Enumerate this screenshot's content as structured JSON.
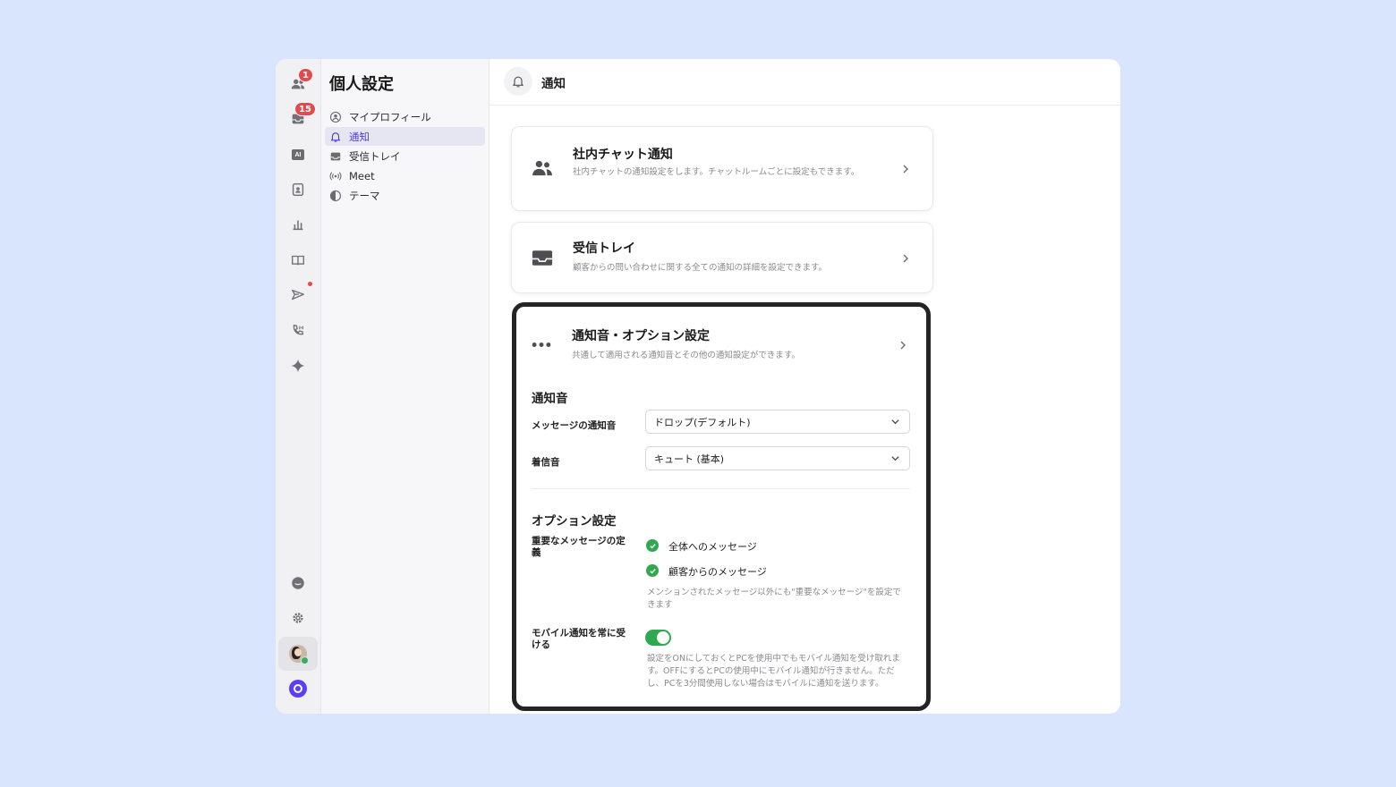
{
  "rail": {
    "contacts_badge": "1",
    "inbox_badge": "15",
    "ai_label": "AI"
  },
  "settings": {
    "title": "個人設定",
    "nav": [
      {
        "label": "マイプロフィール",
        "icon": "user-circle-icon"
      },
      {
        "label": "通知",
        "icon": "bell-icon"
      },
      {
        "label": "受信トレイ",
        "icon": "inbox-icon"
      },
      {
        "label": "Meet",
        "icon": "broadcast-icon"
      },
      {
        "label": "テーマ",
        "icon": "theme-icon"
      }
    ]
  },
  "header": {
    "title": "通知"
  },
  "cards": [
    {
      "title": "社内チャット通知",
      "desc": "社内チャットの通知設定をします。チャットルームごとに設定もできます。",
      "icon": "users-icon"
    },
    {
      "title": "受信トレイ",
      "desc": "顧客からの問い合わせに関する全ての通知の詳細を設定できます。",
      "icon": "inbox-icon"
    },
    {
      "title": "通知音・オプション設定",
      "desc": "共通して適用される通知音とその他の通知設定ができます。",
      "icon": "more-icon"
    }
  ],
  "sounds": {
    "title": "通知音",
    "message_label": "メッセージの通知音",
    "message_value": "ドロップ(デフォルト)",
    "ring_label": "着信音",
    "ring_value": "キュート (基本)"
  },
  "options": {
    "title": "オプション設定",
    "important_label": "重要なメッセージの定義",
    "checks": [
      {
        "label": "全体へのメッセージ",
        "checked": true
      },
      {
        "label": "顧客からのメッセージ",
        "checked": true
      }
    ],
    "important_help": "メンションされたメッセージ以外にも\"重要なメッセージ\"を設定できます",
    "mobile_label": "モバイル通知を常に受ける",
    "mobile_on": true,
    "mobile_help": "設定をONにしておくとPCを使用中でもモバイル通知を受け取れます。OFFにするとPCの使用中にモバイル通知が行きません。ただし、PCを3分間使用しない場合はモバイルに通知を送ります。"
  },
  "colors": {
    "accent": "#4a3fd6",
    "toggle_on": "#2fa84f",
    "badge": "#e5484d",
    "background": "#d8e5fd"
  }
}
